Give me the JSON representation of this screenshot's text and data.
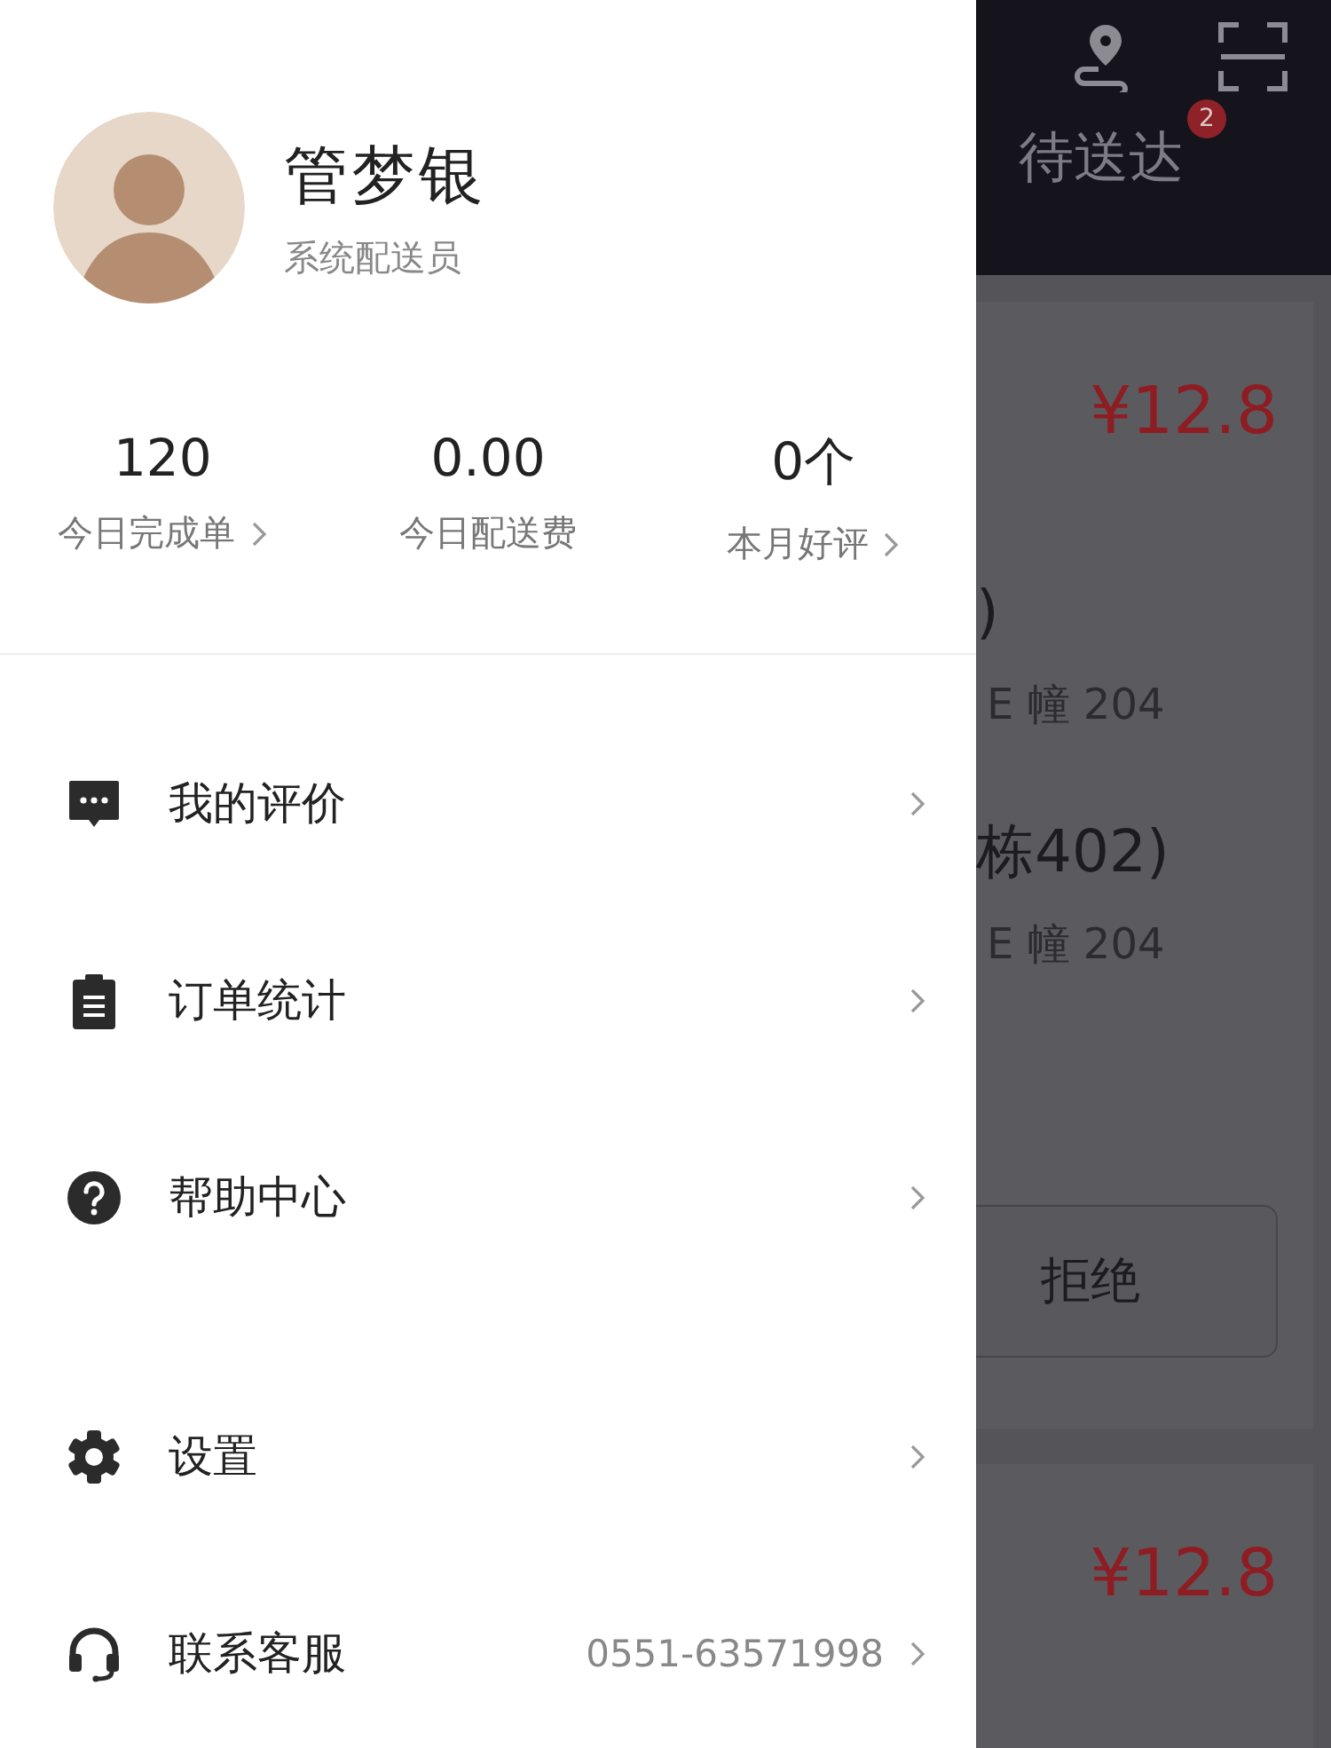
{
  "drawer": {
    "profile": {
      "name": "管梦银",
      "role": "系统配送员"
    },
    "stats": [
      {
        "value": "120",
        "label": "今日完成单",
        "chevron": true
      },
      {
        "value": "0.00",
        "label": "今日配送费",
        "chevron": false
      },
      {
        "value": "0个",
        "label": "本月好评",
        "chevron": true
      }
    ],
    "menu_groups": [
      [
        {
          "kind": "comment",
          "label": "我的评价"
        },
        {
          "kind": "clipboard",
          "label": "订单统计"
        },
        {
          "kind": "help",
          "label": "帮助中心"
        }
      ],
      [
        {
          "kind": "settings",
          "label": "设置"
        },
        {
          "kind": "headset",
          "label": "联系客服",
          "detail": "0551-63571998"
        }
      ]
    ]
  },
  "background": {
    "tab": {
      "label": "待送达",
      "badge": "2"
    },
    "orders": [
      {
        "price": "¥12.8",
        "lines": [
          {
            "kind": "title",
            "text": ")"
          },
          {
            "kind": "address",
            "text": "E 幢 204"
          },
          {
            "kind": "title",
            "text": "栋402)"
          },
          {
            "kind": "address",
            "text": "E 幢 204"
          }
        ],
        "button": "拒绝"
      },
      {
        "price": "¥12.8"
      }
    ]
  }
}
